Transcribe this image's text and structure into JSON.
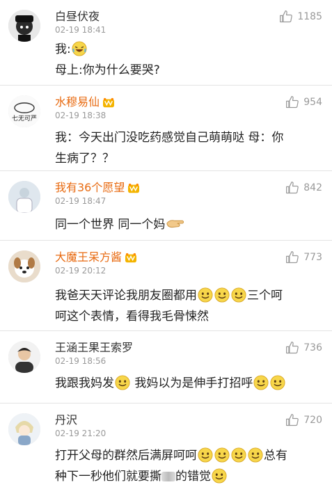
{
  "comments": [
    {
      "name": "白昼伏夜",
      "time": "02-19 18:41",
      "likes": "1185",
      "line1": "我:",
      "line2": "母上:你为什么要哭?"
    },
    {
      "name": "水穆易仙",
      "time": "02-19 18:38",
      "likes": "954",
      "line1": "我：今天出门没吃药感觉自己萌萌哒 母：你",
      "line2": "生病了？？",
      "avatar_text": "七无可严"
    },
    {
      "name": "我有36个愿望",
      "time": "02-19 18:47",
      "likes": "842",
      "line1": "同一个世界 同一个妈"
    },
    {
      "name": "大魔王呆方酱",
      "time": "02-19 20:12",
      "likes": "773",
      "line1a": "我爸天天评论我朋友圈都用",
      "line1b": "三个呵",
      "line2": "呵这个表情，看得我毛骨悚然"
    },
    {
      "name": "王涵王果王索罗",
      "time": "02-19 18:56",
      "likes": "736",
      "line1a": "我跟我妈发",
      "line1b": "我妈以为是伸手打招呼"
    },
    {
      "name": "丹沢",
      "time": "02-19 21:20",
      "likes": "720",
      "line1a": "打开父母的群然后满屏呵呵",
      "line1b": "总有",
      "line2a": "种下一秒他们就要撕",
      "line2b": "的错觉"
    }
  ],
  "icons": {
    "like": "thumbs-up-icon",
    "vip": "vip-crown-icon",
    "emoji": "smile-emoji-icon"
  },
  "colors": {
    "vip_name": "#e86a10",
    "normal_name": "#333333",
    "meta": "#999999"
  }
}
